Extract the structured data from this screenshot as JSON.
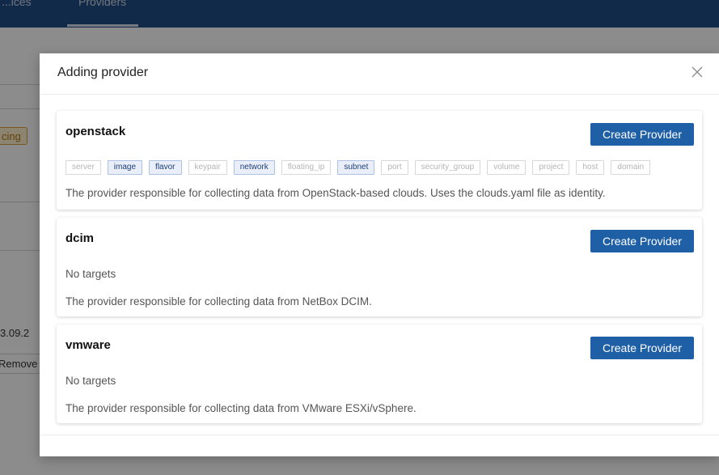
{
  "background": {
    "tabs": [
      "...ices",
      "Providers"
    ],
    "badge_text": "cing",
    "date_text": "3.09.2",
    "remove_label": "Remove"
  },
  "modal": {
    "title": "Adding provider",
    "close_icon": "close-icon",
    "providers": [
      {
        "name": "openstack",
        "button": "Create Provider",
        "targets": [
          {
            "label": "server",
            "active": false
          },
          {
            "label": "image",
            "active": true
          },
          {
            "label": "flavor",
            "active": true
          },
          {
            "label": "keypair",
            "active": false
          },
          {
            "label": "network",
            "active": true
          },
          {
            "label": "floating_ip",
            "active": false
          },
          {
            "label": "subnet",
            "active": true
          },
          {
            "label": "port",
            "active": false
          },
          {
            "label": "security_group",
            "active": false
          },
          {
            "label": "volume",
            "active": false
          },
          {
            "label": "project",
            "active": false
          },
          {
            "label": "host",
            "active": false
          },
          {
            "label": "domain",
            "active": false
          }
        ],
        "description": "The provider responsible for collecting data from OpenStack-based clouds. Uses the clouds.yaml file as identity."
      },
      {
        "name": "dcim",
        "button": "Create Provider",
        "no_targets": "No targets",
        "description": "The provider responsible for collecting data from NetBox DCIM."
      },
      {
        "name": "vmware",
        "button": "Create Provider",
        "no_targets": "No targets",
        "description": "The provider responsible for collecting data from VMware ESXi/vSphere."
      }
    ]
  },
  "colors": {
    "header": "#1f4e86",
    "button": "#1f5fa6",
    "tag_active_bg": "#e9eef8",
    "tag_active_text": "#1f3f77"
  }
}
